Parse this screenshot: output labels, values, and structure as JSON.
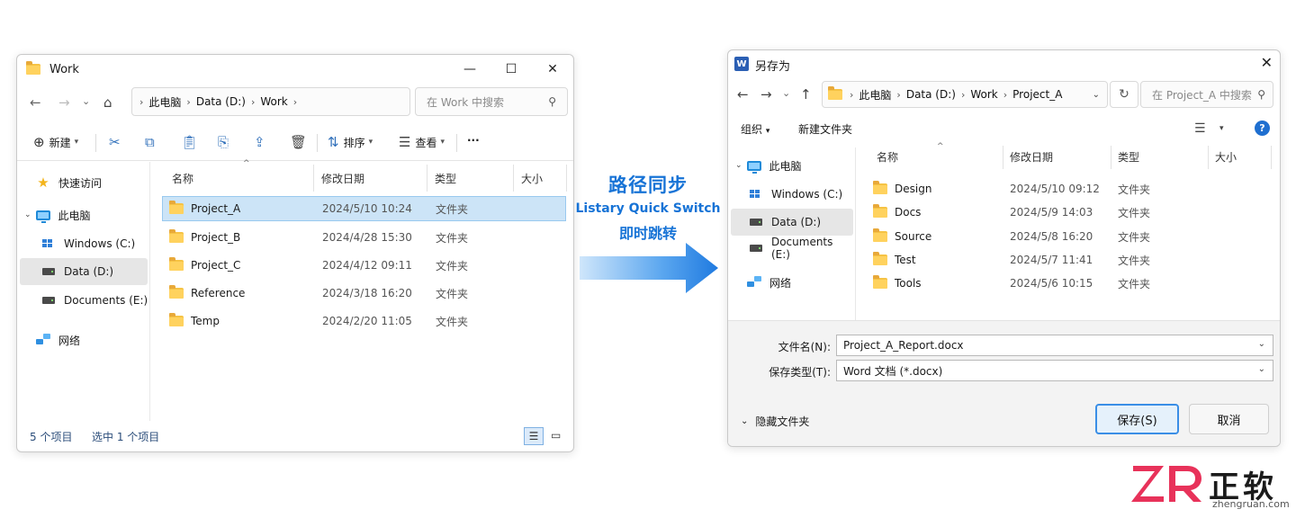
{
  "explorer": {
    "title": "Work",
    "window_controls": {
      "minimize": "—",
      "maximize": "☐",
      "close": "✕"
    },
    "nav": {
      "back": "←",
      "forward": "→",
      "recent": "⌄",
      "up": "⌂"
    },
    "breadcrumb": [
      "此电脑",
      "Data (D:)",
      "Work"
    ],
    "search_placeholder": "在 Work 中搜索",
    "toolbar": {
      "new_label": "新建",
      "sort_label": "排序",
      "view_label": "查看",
      "more_label": "···"
    },
    "sidebar": [
      {
        "label": "快速访问",
        "icon": "star-icon"
      },
      {
        "label": "此电脑",
        "icon": "monitor-icon"
      },
      {
        "label": "Windows (C:)",
        "icon": "windows-drive-icon"
      },
      {
        "label": "Data (D:)",
        "icon": "drive-icon"
      },
      {
        "label": "Documents (E:)",
        "icon": "drive-icon"
      },
      {
        "label": "网络",
        "icon": "network-icon"
      }
    ],
    "columns": {
      "name": "名称",
      "date": "修改日期",
      "type": "类型",
      "size": "大小"
    },
    "rows": [
      {
        "name": "Project_A",
        "date": "2024/5/10 10:24",
        "type": "文件夹"
      },
      {
        "name": "Project_B",
        "date": "2024/4/28 15:30",
        "type": "文件夹"
      },
      {
        "name": "Project_C",
        "date": "2024/4/12 09:11",
        "type": "文件夹"
      },
      {
        "name": "Reference",
        "date": "2024/3/18 16:20",
        "type": "文件夹"
      },
      {
        "name": "Temp",
        "date": "2024/2/20 11:05",
        "type": "文件夹"
      }
    ],
    "status_count": "5 个项目",
    "status_selected": "选中 1 个项目"
  },
  "middle": {
    "title": "路径同步",
    "subtitle1": "Listary Quick Switch",
    "subtitle2": "即时跳转",
    "arrow_color": "#1f7ae0"
  },
  "saveas": {
    "title": "另存为",
    "app_logo": "W",
    "breadcrumb": [
      "此电脑",
      "Data (D:)",
      "Work",
      "Project_A"
    ],
    "search_placeholder": "在 Project_A 中搜索",
    "organize_label": "组织",
    "new_folder_label": "新建文件夹",
    "sidebar": [
      {
        "label": "此电脑",
        "icon": "monitor-icon"
      },
      {
        "label": "Windows (C:)",
        "icon": "windows-drive-icon"
      },
      {
        "label": "Data (D:)",
        "icon": "drive-icon"
      },
      {
        "label": "Documents (E:)",
        "icon": "drive-icon"
      },
      {
        "label": "网络",
        "icon": "network-icon"
      }
    ],
    "columns": {
      "name": "名称",
      "date": "修改日期",
      "type": "类型",
      "size": "大小"
    },
    "rows": [
      {
        "name": "Design",
        "date": "2024/5/10 09:12",
        "type": "文件夹"
      },
      {
        "name": "Docs",
        "date": "2024/5/9 14:03",
        "type": "文件夹"
      },
      {
        "name": "Source",
        "date": "2024/5/8 16:20",
        "type": "文件夹"
      },
      {
        "name": "Test",
        "date": "2024/5/7 11:41",
        "type": "文件夹"
      },
      {
        "name": "Tools",
        "date": "2024/5/6 10:15",
        "type": "文件夹"
      }
    ],
    "filename_label": "文件名(N):",
    "filename_value": "Project_A_Report.docx",
    "filetype_label": "保存类型(T):",
    "filetype_value": "Word 文档 (*.docx)",
    "hide_folders_label": "隐藏文件夹",
    "save_label": "保存(S)",
    "cancel_label": "取消"
  },
  "brand": {
    "logo_text": "ZR",
    "name": "正软",
    "url": "zhengruan.com",
    "accent": "#e8325a"
  }
}
